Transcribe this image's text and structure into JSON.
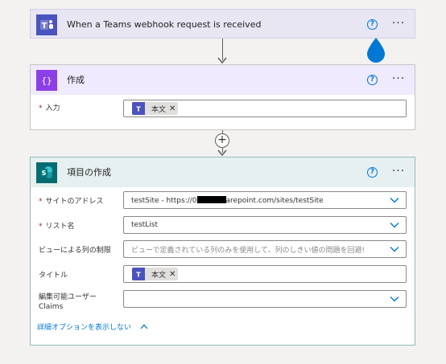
{
  "trigger": {
    "title": "When a Teams webhook request is received",
    "help": "?",
    "more": "···"
  },
  "compose": {
    "title": "作成",
    "help": "?",
    "more": "···",
    "input_label": "入力",
    "required_mark": "*",
    "token_label": "本文",
    "token_remove": "✕"
  },
  "create_item": {
    "title": "項目の作成",
    "help": "?",
    "more": "···",
    "site_label": "サイトのアドレス",
    "site_value_prefix": "testSite - https://0",
    "site_value_suffix": "arepoint.com/sites/testSite",
    "list_label": "リスト名",
    "list_value": "testList",
    "view_label": "ビューによる列の制限",
    "view_placeholder": "ビューで定義されている列のみを使用して、列のしきい値の問題を回避!",
    "title_label": "タイトル",
    "title_token": "本文",
    "title_token_remove": "✕",
    "editor_label_line1": "編集可能ユーザー",
    "editor_label_line2": "Claims",
    "required_mark": "*",
    "advanced_link": "詳細オプションを表示しない"
  },
  "flow": {
    "add_step": "+"
  },
  "colors": {
    "teams": "#4b53bc",
    "compose": "#8c3fe6",
    "sharepoint": "#036c70",
    "accent": "#0078d4"
  }
}
